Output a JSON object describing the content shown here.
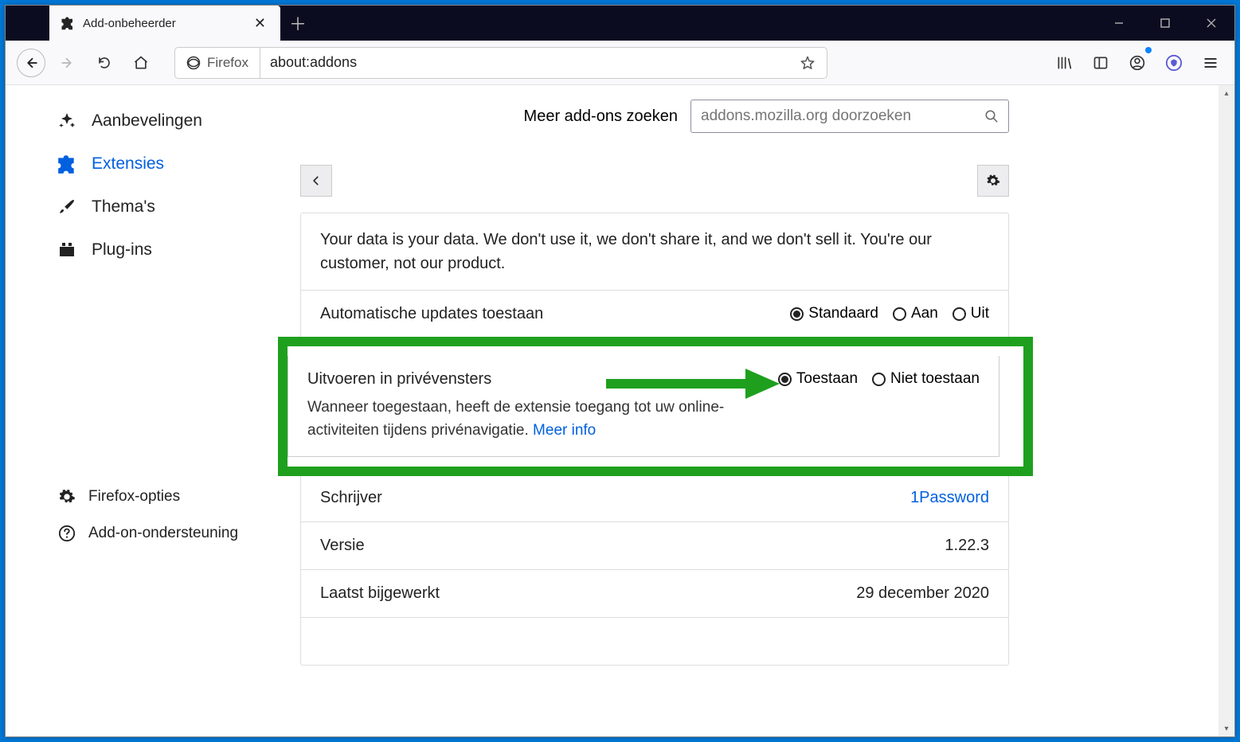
{
  "tab": {
    "title": "Add-onbeheerder"
  },
  "urlbar": {
    "identity": "Firefox",
    "url": "about:addons"
  },
  "search": {
    "label": "Meer add-ons zoeken",
    "placeholder": "addons.mozilla.org doorzoeken"
  },
  "sidebar": {
    "items": [
      {
        "label": "Aanbevelingen"
      },
      {
        "label": "Extensies"
      },
      {
        "label": "Thema's"
      },
      {
        "label": "Plug-ins"
      }
    ],
    "footer": [
      {
        "label": "Firefox-opties"
      },
      {
        "label": "Add-on-ondersteuning"
      }
    ]
  },
  "detail": {
    "blurb": "Your data is your data. We don't use it, we don't share it, and we don't sell it. You're our customer, not our product.",
    "updates_label": "Automatische updates toestaan",
    "updates_options": {
      "default": "Standaard",
      "on": "Aan",
      "off": "Uit"
    },
    "private_label": "Uitvoeren in privévensters",
    "private_desc": "Wanneer toegestaan, heeft de extensie toegang tot uw online-activiteiten tijdens privénavigatie. ",
    "private_more": "Meer info",
    "private_options": {
      "allow": "Toestaan",
      "deny": "Niet toestaan"
    },
    "author_label": "Schrijver",
    "author_value": "1Password",
    "version_label": "Versie",
    "version_value": "1.22.3",
    "updated_label": "Laatst bijgewerkt",
    "updated_value": "29 december 2020"
  }
}
